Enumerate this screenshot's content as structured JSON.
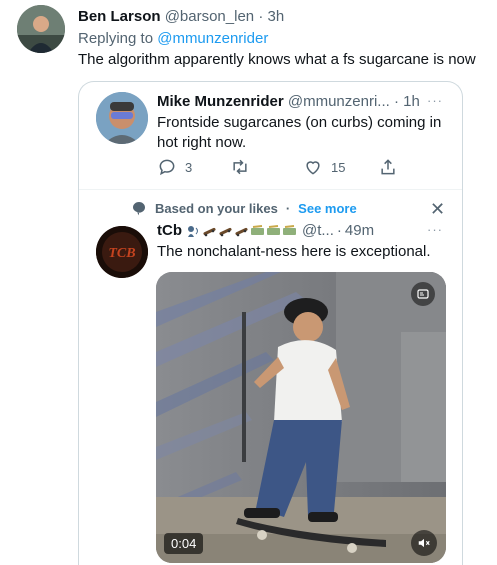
{
  "outer_tweet": {
    "name": "Ben Larson",
    "handle": "@barson_len",
    "dot": "·",
    "time": "3h",
    "replying_prefix": "Replying to",
    "replying_handle": "@mmunzenrider",
    "text": "The algorithm apparently knows what a fs sugarcane is now"
  },
  "quoted_tweet": {
    "name": "Mike Munzenrider",
    "handle": "@mmunzenri...",
    "dot": "·",
    "time": "1h",
    "more_dots": "···",
    "text": "Frontside sugarcanes (on curbs) coming in hot right now.",
    "actions": {
      "reply_count": "3",
      "retweet_count": "",
      "like_count": "15"
    }
  },
  "recommended": {
    "based_on": "Based on your likes",
    "dot": "·",
    "see_more": "See more",
    "close": "✕"
  },
  "tcb_tweet": {
    "name": "tCb",
    "handle": "@t...",
    "dot": "·",
    "time": "49m",
    "more_dots": "···",
    "text": "The nonchalant-ness here is exceptional.",
    "video": {
      "duration": "0:04"
    }
  },
  "colors": {
    "accent": "#1d9bf0",
    "text": "#0f1419",
    "muted": "#536471",
    "border": "#cfd9de"
  },
  "icons": [
    "reply-icon",
    "retweet-icon",
    "like-icon",
    "share-icon",
    "chat-bubble-icon",
    "close-icon",
    "mute-icon",
    "gif-icon"
  ]
}
